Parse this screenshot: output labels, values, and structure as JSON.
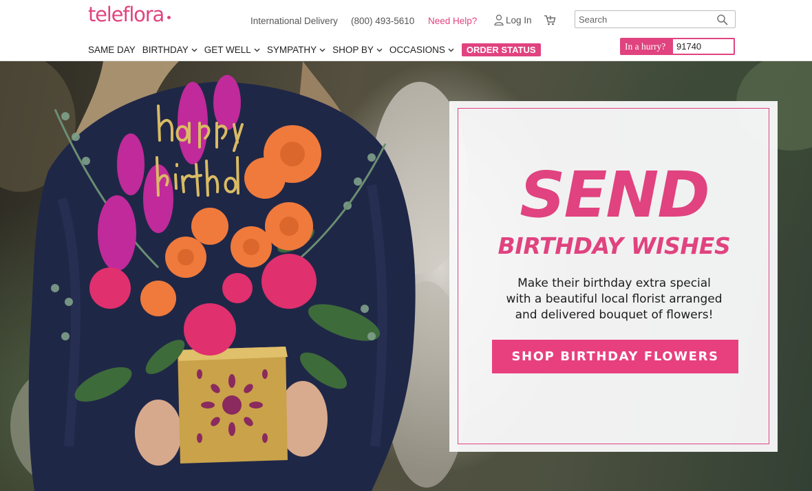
{
  "header": {
    "logo_text": "teleflora",
    "utility_links": {
      "international": "International Delivery",
      "phone": "(800) 493-5610",
      "help": "Need Help?",
      "login": "Log In"
    },
    "search": {
      "placeholder": "Search",
      "value": ""
    },
    "nav": [
      {
        "label": "SAME DAY",
        "has_dropdown": false
      },
      {
        "label": "BIRTHDAY",
        "has_dropdown": true
      },
      {
        "label": "GET WELL",
        "has_dropdown": true
      },
      {
        "label": "SYMPATHY",
        "has_dropdown": true
      },
      {
        "label": "SHOP BY",
        "has_dropdown": true
      },
      {
        "label": "OCCASIONS",
        "has_dropdown": true
      }
    ],
    "order_status": "ORDER STATUS",
    "hurry": {
      "label": "In a hurry?",
      "zip_value": "91740"
    }
  },
  "hero": {
    "headline": "SEND",
    "subheadline": "BIRTHDAY WISHES",
    "body_lines": [
      "Make their birthday extra special",
      "with a beautiful local florist arranged",
      "and delivered bouquet of flowers!"
    ],
    "cta": "SHOP BIRTHDAY FLOWERS",
    "topper_text": "happy birthday"
  },
  "colors": {
    "brand_pink": "#e0437f",
    "sweater_navy": "#1f2747",
    "vase_gold": "#c9a24a"
  }
}
